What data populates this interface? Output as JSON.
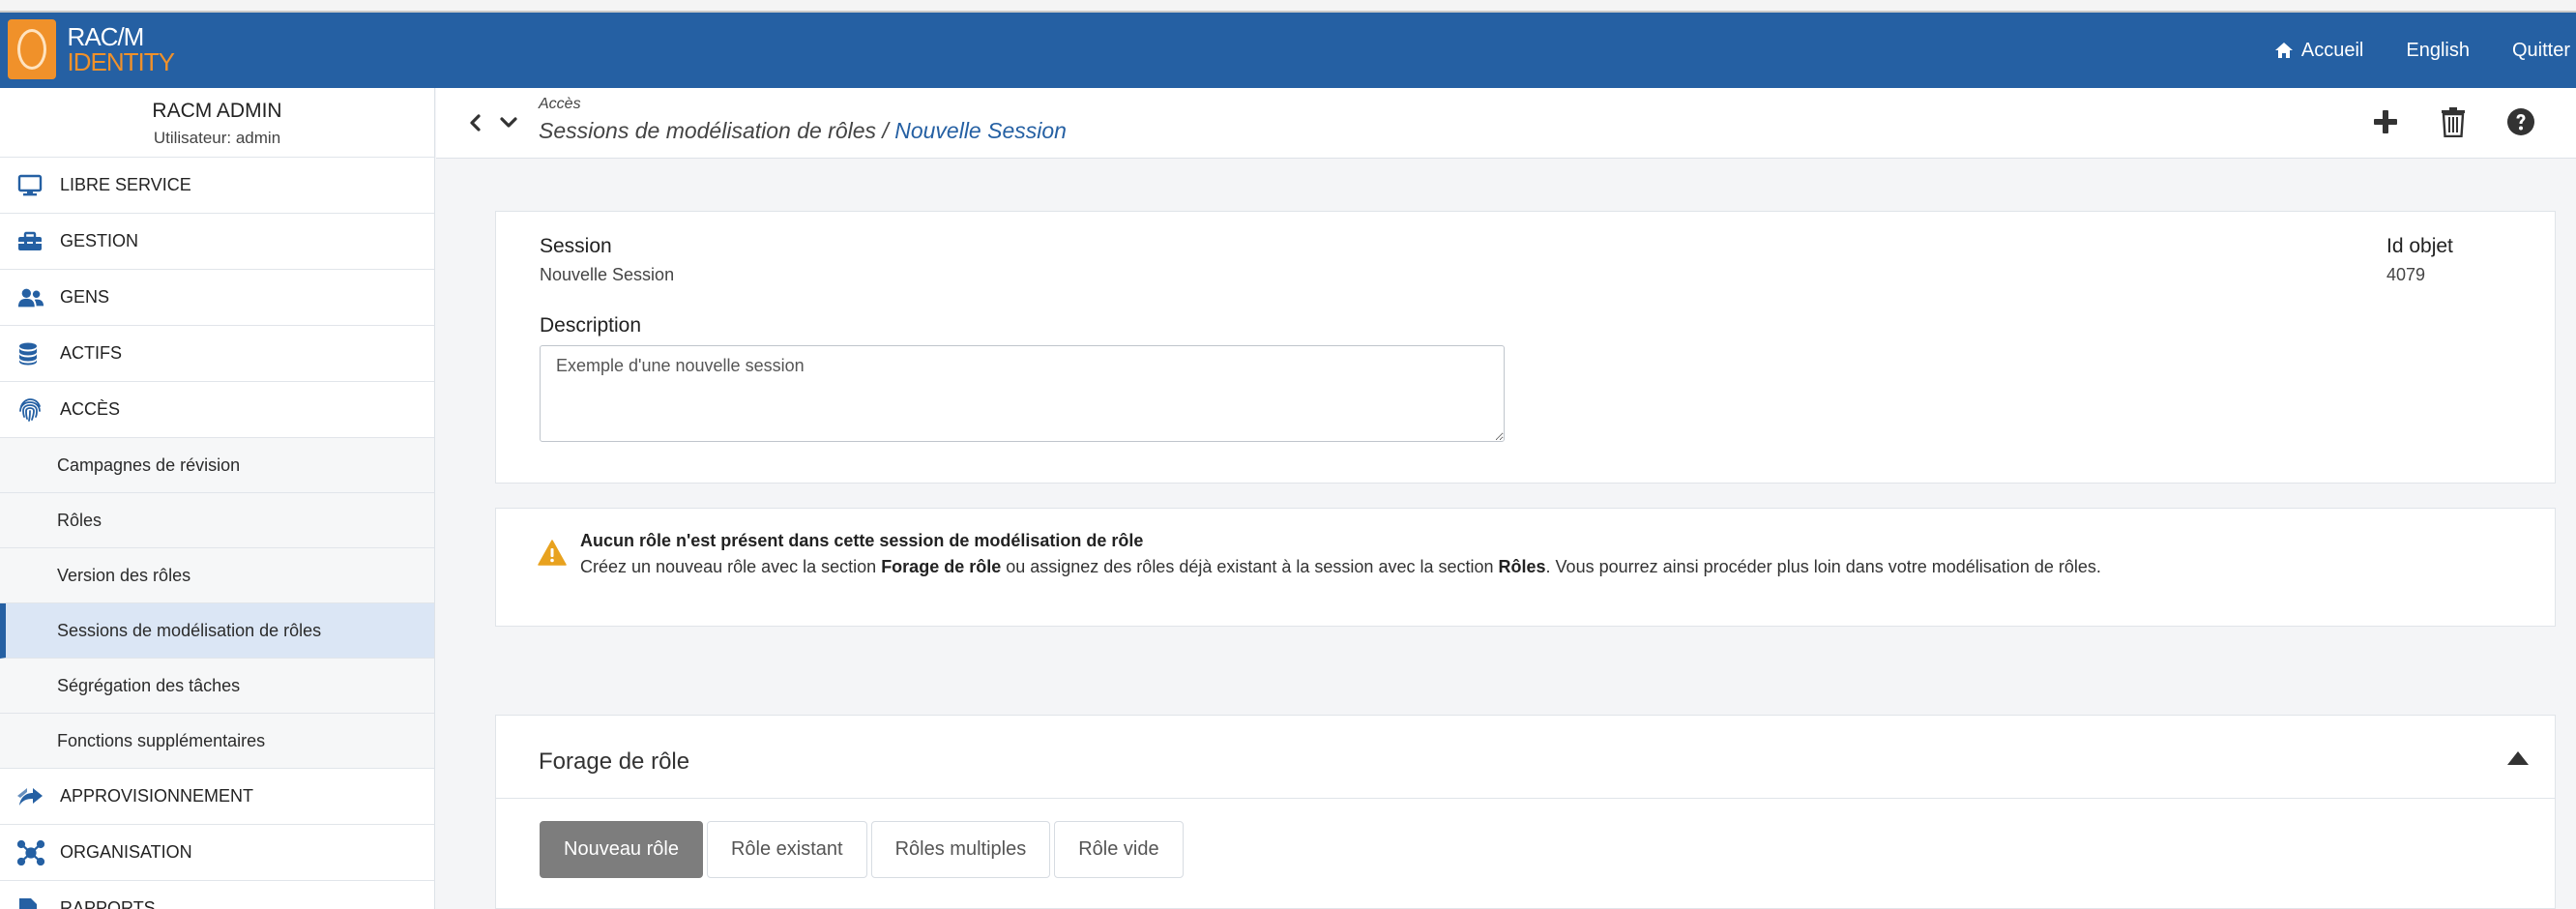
{
  "header": {
    "logo_line1": "RAC/M",
    "logo_line2": "IDENTITY",
    "nav": {
      "home": "Accueil",
      "language": "English",
      "quit": "Quitter"
    },
    "color": "#2560a3"
  },
  "sidebar": {
    "profile": {
      "name": "RACM ADMIN",
      "user": "Utilisateur: admin"
    },
    "sections": [
      {
        "label": "LIBRE SERVICE",
        "icon": "monitor-icon"
      },
      {
        "label": "GESTION",
        "icon": "toolbox-icon"
      },
      {
        "label": "GENS",
        "icon": "users-icon"
      },
      {
        "label": "ACTIFS",
        "icon": "database-icon"
      },
      {
        "label": "ACCÈS",
        "icon": "fingerprint-icon"
      }
    ],
    "access_items": [
      "Campagnes de révision",
      "Rôles",
      "Version des rôles",
      "Sessions de modélisation de rôles",
      "Ségrégation des tâches",
      "Fonctions supplémentaires"
    ],
    "active_item": "Sessions de modélisation de rôles",
    "more_sections": [
      {
        "label": "APPROVISIONNEMENT",
        "icon": "share-arrow-icon"
      },
      {
        "label": "ORGANISATION",
        "icon": "network-icon"
      },
      {
        "label": "RAPPORTS",
        "icon": "report-icon"
      }
    ]
  },
  "breadcrumb": {
    "parent": "Accès",
    "section": "Sessions de modélisation de rôles",
    "separator": " / ",
    "current": "Nouvelle Session"
  },
  "session": {
    "session_label": "Session",
    "session_value": "Nouvelle Session",
    "id_label": "Id objet",
    "id_value": "4079",
    "description_label": "Description",
    "description_value": "Exemple d'une nouvelle session"
  },
  "warning": {
    "title": "Aucun rôle n'est présent dans cette session de modélisation de rôle",
    "text_1": "Créez un nouveau rôle avec la section ",
    "bold_1": "Forage de rôle",
    "text_2": " ou assignez des rôles déjà existant à la session avec la section ",
    "bold_2": "Rôles",
    "text_3": ". Vous pourrez ainsi procéder plus loin dans votre modélisation de rôles."
  },
  "forage": {
    "title": "Forage de rôle",
    "tabs": [
      "Nouveau rôle",
      "Rôle existant",
      "Rôles multiples",
      "Rôle vide"
    ],
    "active_tab": "Nouveau rôle"
  }
}
